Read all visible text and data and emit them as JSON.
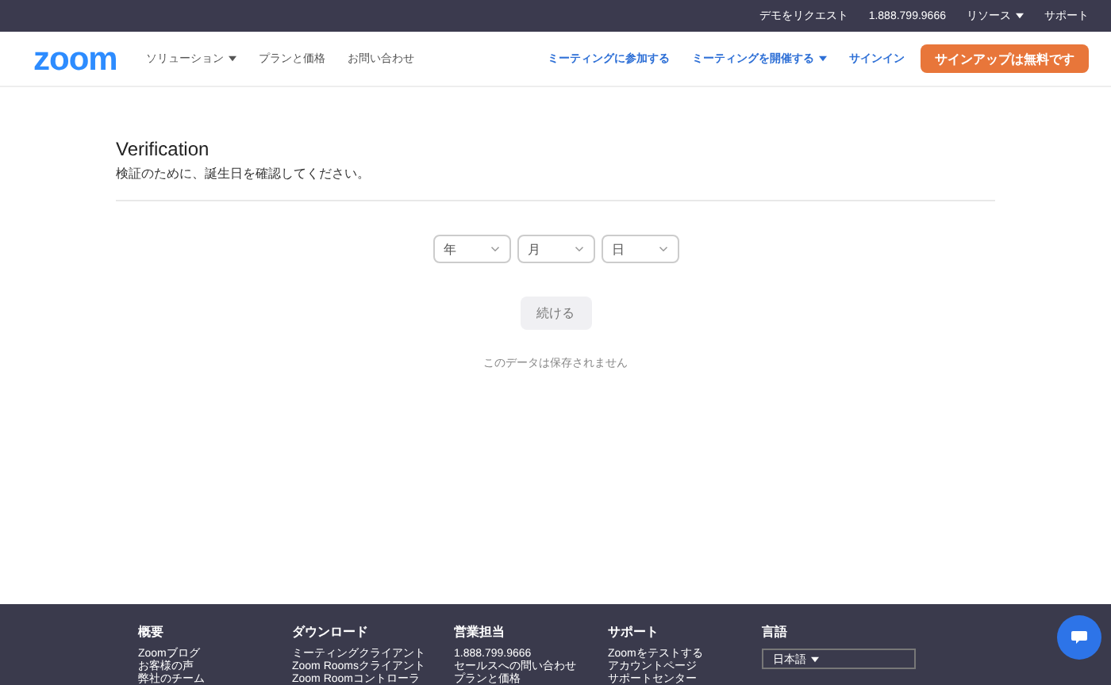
{
  "top_bar": {
    "links": [
      {
        "label": "デモをリクエスト",
        "dropdown": false
      },
      {
        "label": "1.888.799.9666",
        "dropdown": false
      },
      {
        "label": "リソース",
        "dropdown": true
      },
      {
        "label": "サポート",
        "dropdown": false
      }
    ]
  },
  "header": {
    "logo": "zoom",
    "nav": [
      {
        "label": "ソリューション",
        "dropdown": true
      },
      {
        "label": "プランと価格",
        "dropdown": false
      },
      {
        "label": "お問い合わせ",
        "dropdown": false
      }
    ],
    "right_nav": [
      {
        "label": "ミーティングに参加する",
        "dropdown": false
      },
      {
        "label": "ミーティングを開催する",
        "dropdown": true
      },
      {
        "label": "サインイン",
        "dropdown": false
      }
    ],
    "signup_button": "サインアップは無料です"
  },
  "verification": {
    "title": "Verification",
    "subtitle": "検証のために、誕生日を確認してください。",
    "selects": [
      {
        "placeholder": "年"
      },
      {
        "placeholder": "月"
      },
      {
        "placeholder": "日"
      }
    ],
    "continue_button": {
      "label": "続ける",
      "disabled": true
    },
    "note": "このデータは保存されません"
  },
  "footer": {
    "columns": [
      {
        "heading": "概要",
        "links": [
          "Zoomブログ",
          "お客様の声",
          "弊社のチーム"
        ]
      },
      {
        "heading": "ダウンロード",
        "links": [
          "ミーティングクライアント",
          "Zoom Roomsクライアント",
          "Zoom Roomコントローラ"
        ]
      },
      {
        "heading": "営業担当",
        "links": [
          "1.888.799.9666",
          "セールスへの問い合わせ",
          "プランと価格"
        ]
      },
      {
        "heading": "サポート",
        "links": [
          "Zoomをテストする",
          "アカウントページ",
          "サポートセンター"
        ]
      }
    ],
    "language": {
      "heading": "言語",
      "value": "日本語"
    }
  }
}
